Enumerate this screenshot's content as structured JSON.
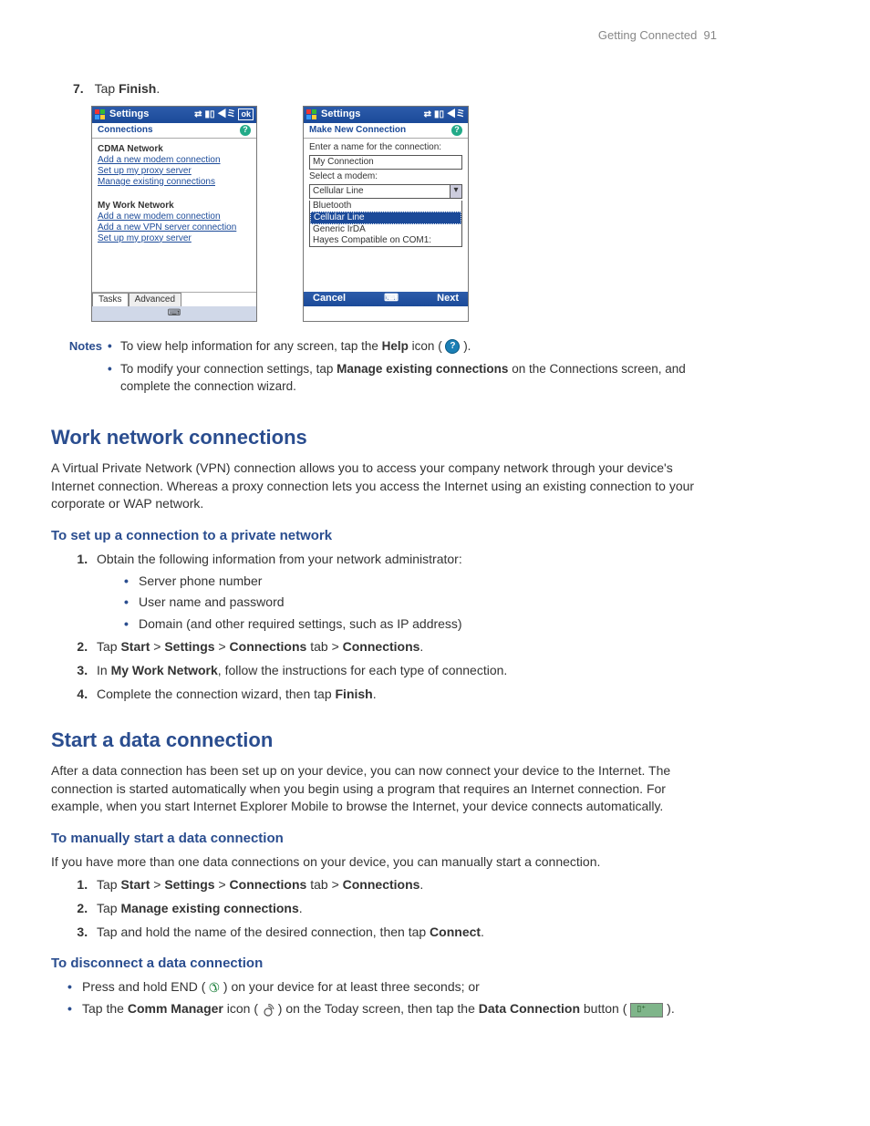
{
  "page_header": {
    "section": "Getting Connected",
    "number": "91"
  },
  "step7": {
    "pre": "Tap ",
    "bold": "Finish",
    "post": "."
  },
  "screen1": {
    "title": "Settings",
    "ok": "ok",
    "subbar": "Connections",
    "group1_title": "CDMA Network",
    "group1_links": [
      "Add a new modem connection",
      "Set up my proxy server",
      "Manage existing connections"
    ],
    "group2_title": "My Work Network",
    "group2_links": [
      "Add a new modem connection",
      "Add a new VPN server connection",
      "Set up my proxy server"
    ],
    "tabs": [
      "Tasks",
      "Advanced"
    ],
    "kbd": "⌨"
  },
  "screen2": {
    "title": "Settings",
    "subbar": "Make New Connection",
    "label1": "Enter a name for the connection:",
    "input1": "My Connection",
    "label2": "Select a modem:",
    "select_val": "Cellular Line",
    "options": [
      "Bluetooth",
      "Cellular Line",
      "Generic IrDA",
      "Hayes Compatible on COM1:"
    ],
    "selected_index": 1,
    "btn_cancel": "Cancel",
    "btn_next": "Next",
    "kbd": "⌨"
  },
  "notes": {
    "label": "Notes",
    "items": [
      {
        "pre": "To view help information for any screen, tap the ",
        "b1": "Help",
        "mid": " icon ( ",
        "post": " )."
      },
      {
        "pre": "To modify your connection settings, tap ",
        "b1": "Manage existing connections",
        "post": " on the Connections screen, and complete the connection wizard."
      }
    ]
  },
  "h2_work": "Work network connections",
  "p_work": "A Virtual Private Network (VPN) connection allows you to access your company network through your device's Internet connection. Whereas a proxy connection lets you access the Internet using an existing connection to your corporate or WAP network.",
  "h3_private": "To set up a connection to a private network",
  "priv_steps": {
    "s1": "Obtain the following information from your network administrator:",
    "s1_bullets": [
      "Server phone number",
      "User name and password",
      "Domain (and other required settings, such as IP address)"
    ],
    "s2": {
      "parts": [
        "Tap ",
        "Start",
        " > ",
        "Settings",
        " > ",
        "Connections",
        " tab > ",
        "Connections",
        "."
      ]
    },
    "s3": {
      "parts": [
        "In ",
        "My Work Network",
        ", follow the instructions for each type of connection."
      ]
    },
    "s4": {
      "parts": [
        "Complete the connection wizard, then tap ",
        "Finish",
        "."
      ]
    }
  },
  "h2_start": "Start a data connection",
  "p_start": "After a data connection has been set up on your device, you can now connect your device to the Internet. The connection is started automatically when you begin using a program that requires an Internet connection. For example, when you start Internet Explorer Mobile to browse the Internet, your device connects automatically.",
  "h3_manual": "To manually start a data connection",
  "p_manual": "If you have more than one data connections on your device, you can manually start a connection.",
  "manual_steps": {
    "s1": {
      "parts": [
        "Tap ",
        "Start",
        " > ",
        "Settings",
        " > ",
        "Connections",
        " tab > ",
        "Connections",
        "."
      ]
    },
    "s2": {
      "parts": [
        "Tap ",
        "Manage existing connections",
        "."
      ]
    },
    "s3": {
      "parts": [
        "Tap and hold the name of the desired connection, then tap ",
        "Connect",
        "."
      ]
    }
  },
  "h3_disc": "To disconnect a data connection",
  "disc_bullets": {
    "b1": {
      "pre": "Press and hold END ( ",
      "post": " ) on your device for at least three seconds; or"
    },
    "b2": {
      "pre": "Tap the ",
      "b1": "Comm Manager",
      "mid1": " icon ( ",
      "mid2": " ) on the Today screen, then tap the ",
      "b2": "Data Connection",
      "mid3": " button ( ",
      "post": " )."
    }
  }
}
